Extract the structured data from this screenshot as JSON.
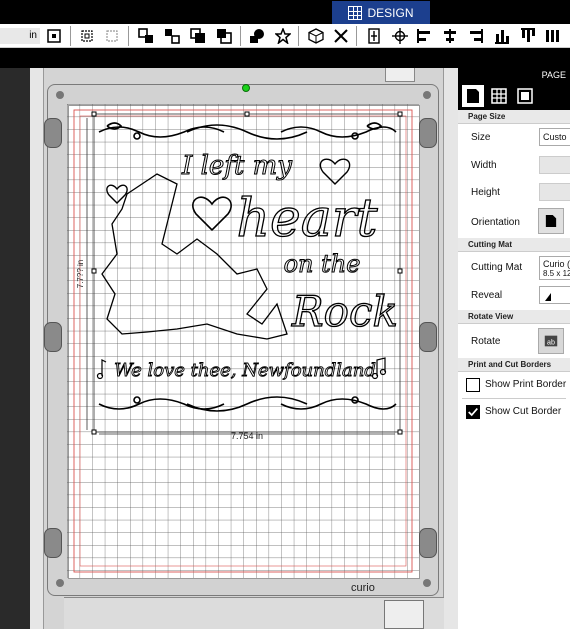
{
  "toolbar": {
    "unit_value": "in",
    "design_tab": "DESIGN"
  },
  "icons": [
    "page-setup-icon",
    "grid-icon",
    "mat-icon",
    "group-icon",
    "ungroup-icon",
    "arrange-front-icon",
    "arrange-back-icon",
    "fill-shape-icon",
    "star-shape-icon",
    "3d-box-icon",
    "close-icon",
    "align-icon",
    "crosshair-icon",
    "align-left-icon",
    "align-center-icon",
    "align-right-icon",
    "distribute-icon",
    "distribute-vertical-icon"
  ],
  "panel": {
    "title": "PAGE",
    "sections": {
      "page_size": "Page Size",
      "cutting_mat": "Cutting Mat",
      "rotate_view": "Rotate View",
      "print_cut": "Print and Cut Borders"
    },
    "size_label": "Size",
    "size_value": "Custo",
    "width_label": "Width",
    "height_label": "Height",
    "orientation_label": "Orientation",
    "cutting_mat_label": "Cutting Mat",
    "cutting_mat_value": "Curio (",
    "cutting_mat_size": "8.5 x 12",
    "reveal_label": "Reveal",
    "rotate_label": "Rotate",
    "show_print_border": "Show Print Border",
    "show_cut_border": "Show Cut Border",
    "print_border_checked": false,
    "cut_border_checked": true
  },
  "canvas": {
    "design_lines": [
      "I left my",
      "heart",
      "on the",
      "Rock",
      "We love thee, Newfoundland"
    ],
    "width_dim": "7.754 in",
    "height_dim": "7.7?? in",
    "mat_brand": "curio"
  }
}
